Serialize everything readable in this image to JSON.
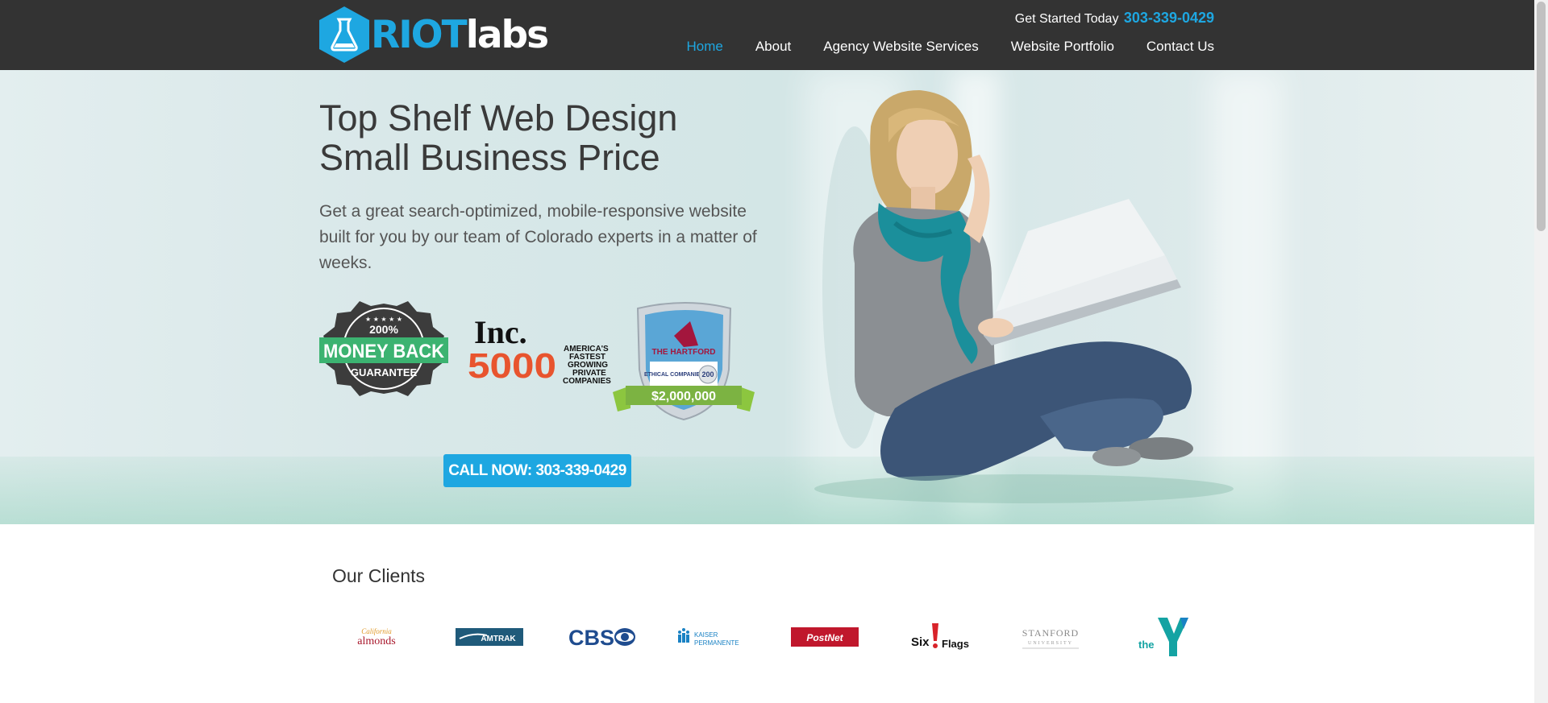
{
  "brand": {
    "riot": "RIOT",
    "labs": "labs"
  },
  "header": {
    "get_started": "Get Started Today",
    "phone": "303-339-0429"
  },
  "nav": {
    "items": [
      {
        "label": "Home",
        "active": true
      },
      {
        "label": "About"
      },
      {
        "label": "Agency Website Services"
      },
      {
        "label": "Website Portfolio"
      },
      {
        "label": "Contact Us"
      }
    ]
  },
  "hero": {
    "title": "Top Shelf Web Design Small Business Price",
    "subtitle": "Get a great search-optimized, mobile-responsive website built for you by our team of Colorado experts in a matter of weeks.",
    "cta": "CALL NOW: 303-339-0429",
    "badges": {
      "money_back": {
        "pct": "200%",
        "line1": "MONEY BACK",
        "line2": "GUARANTEE"
      },
      "inc": {
        "word": "Inc.",
        "num": "5000",
        "l1": "AMERICA'S",
        "l2": "FASTEST",
        "l3": "GROWING",
        "l4": "PRIVATE",
        "l5": "COMPANIES"
      },
      "hartford": {
        "name": "THE HARTFORD",
        "award": "ETHICAL COMPANIES",
        "years": "200",
        "amount": "$2,000,000"
      }
    }
  },
  "clients": {
    "title": "Our Clients",
    "logos": [
      {
        "name": "almonds",
        "text": "almonds"
      },
      {
        "name": "amtrak",
        "text": "AMTRAK"
      },
      {
        "name": "cbs",
        "text": "CBS"
      },
      {
        "name": "kaiser",
        "text1": "KAISER",
        "text2": "PERMANENTE"
      },
      {
        "name": "postnet",
        "text": "PostNet"
      },
      {
        "name": "six-flags",
        "text1": "Six",
        "text2": "Flags"
      },
      {
        "name": "stanford",
        "text1": "STANFORD",
        "text2": "UNIVERSITY"
      },
      {
        "name": "ymca",
        "text": "the"
      }
    ]
  },
  "colors": {
    "accent": "#1ea7e1",
    "header_bg": "#333333",
    "badge_green": "#3cb371"
  }
}
